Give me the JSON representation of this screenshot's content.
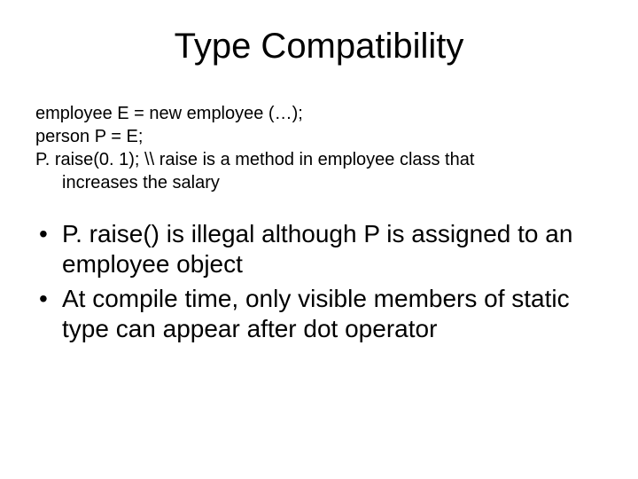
{
  "title": "Type Compatibility",
  "code": {
    "line1": "employee E = new employee (…);",
    "line2": "person P = E;",
    "line3": "P. raise(0. 1); \\\\ raise is a method in employee class that",
    "line3b": "increases the salary"
  },
  "bullets": [
    "P. raise() is illegal although P is assigned to an employee object",
    "At compile time, only visible members of static type can appear after dot operator"
  ]
}
